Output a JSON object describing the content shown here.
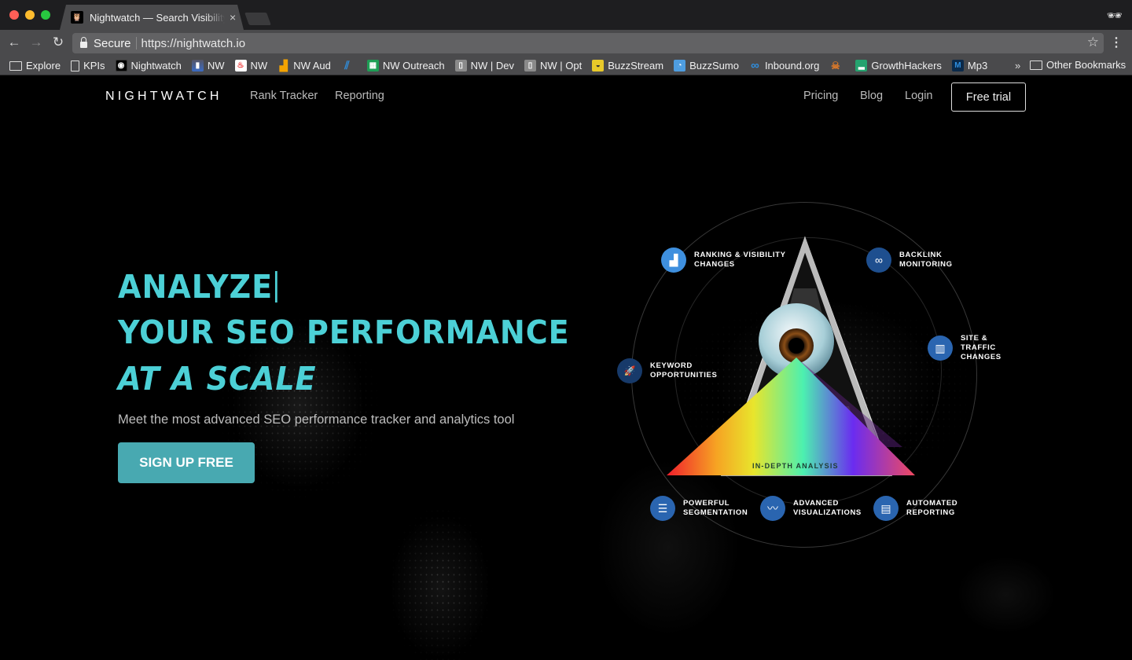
{
  "browser": {
    "tab_title": "Nightwatch — Search Visibility",
    "tab_close": "×",
    "secure_label": "Secure",
    "url": "https://nightwatch.io",
    "icons": {
      "back": "←",
      "forward": "→",
      "reload": "↻",
      "star": "☆",
      "menu": "⋮",
      "incognito": "🕶"
    },
    "bookmarks": [
      {
        "label": "Explore",
        "icon": "folder-icon",
        "color": ""
      },
      {
        "label": "KPIs",
        "icon": "page-icon",
        "color": ""
      },
      {
        "label": "Nightwatch",
        "icon": "owl-icon",
        "color": "#000000"
      },
      {
        "label": "NW",
        "icon": "bars-icon",
        "color": "#3a6bc4"
      },
      {
        "label": "NW",
        "icon": "fire-icon",
        "color": "#ffffff"
      },
      {
        "label": "NW Aud",
        "icon": "analytics-icon",
        "color": "#f4a300"
      },
      {
        "label": "",
        "icon": "stripes-icon",
        "color": "#2f8fdf"
      },
      {
        "label": "NW Outreach",
        "icon": "sheets-icon",
        "color": "#1e9e55"
      },
      {
        "label": "NW | Dev",
        "icon": "trello-icon",
        "color": "#8a8a8a"
      },
      {
        "label": "NW | Opt",
        "icon": "trello-icon",
        "color": "#8a8a8a"
      },
      {
        "label": "BuzzStream",
        "icon": "buzzstream-icon",
        "color": "#e8c92a"
      },
      {
        "label": "BuzzSumo",
        "icon": "rss-icon",
        "color": "#4e9de0"
      },
      {
        "label": "Inbound.org",
        "icon": "infinity-icon",
        "color": ""
      },
      {
        "label": "",
        "icon": "skull-icon",
        "color": ""
      },
      {
        "label": "GrowthHackers",
        "icon": "growth-icon",
        "color": "#25a36f"
      },
      {
        "label": "Mp3",
        "icon": "m-icon",
        "color": "#0b2a4a"
      }
    ],
    "more_bookmarks": "»",
    "other_bookmarks": "Other Bookmarks"
  },
  "nav": {
    "logo": "NIGHTWATCH",
    "left_links": [
      "Rank Tracker",
      "Reporting"
    ],
    "right_links": [
      "Pricing",
      "Blog",
      "Login"
    ],
    "cta": "Free trial"
  },
  "hero": {
    "line1": "ANALYZE",
    "line2": "YOUR SEO PERFORMANCE",
    "line3": "AT A SCALE",
    "subtitle": "Meet the most advanced SEO performance tracker and analytics tool",
    "cta": "SIGN UP FREE",
    "accent_color": "#4cd0d6",
    "button_color": "#48a9b1"
  },
  "diagram": {
    "center_label": "IN-DEPTH ANALYSIS",
    "features": [
      {
        "label": "RANKING & VISIBILITY\nCHANGES",
        "icon": "area-chart-icon",
        "glyph": "▟"
      },
      {
        "label": "BACKLINK\nMONITORING",
        "icon": "link-icon",
        "glyph": "∞"
      },
      {
        "label": "SITE & TRAFFIC\nCHANGES",
        "icon": "bar-chart-icon",
        "glyph": "▥"
      },
      {
        "label": "KEYWORD\nOPPORTUNITIES",
        "icon": "rocket-icon",
        "glyph": "🚀"
      },
      {
        "label": "POWERFUL\nSEGMENTATION",
        "icon": "list-icon",
        "glyph": "☰"
      },
      {
        "label": "ADVANCED\nVISUALIZATIONS",
        "icon": "line-chart-icon",
        "glyph": "〰"
      },
      {
        "label": "AUTOMATED\nREPORTING",
        "icon": "document-icon",
        "glyph": "▤"
      }
    ]
  }
}
